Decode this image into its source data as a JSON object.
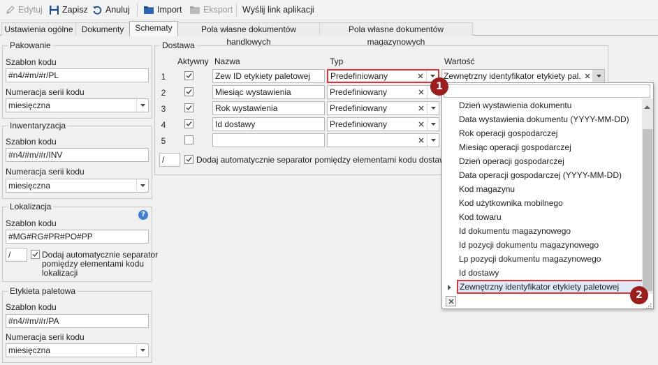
{
  "toolbar": {
    "edit_label": "Edytuj",
    "save_label": "Zapisz",
    "cancel_label": "Anuluj",
    "import_label": "Import",
    "export_label": "Eksport",
    "send_link_label": "Wyślij link aplikacji"
  },
  "tabs": [
    {
      "label": "Ustawienia ogólne",
      "active": false
    },
    {
      "label": "Dokumenty",
      "active": false
    },
    {
      "label": "Schematy",
      "active": true
    },
    {
      "label": "Pola własne dokumentów handlowych",
      "active": false
    },
    {
      "label": "Pola własne dokumentów magazynowych",
      "active": false
    }
  ],
  "left": {
    "pakowanie": {
      "title": "Pakowanie",
      "template_label": "Szablon kodu",
      "template_value": "#n4/#m/#r/PL",
      "numbering_label": "Numeracja serii kodu",
      "numbering_value": "miesięczna"
    },
    "inwentaryzacja": {
      "title": "Inwentaryzacja",
      "template_label": "Szablon kodu",
      "template_value": "#n4/#m/#r/INV",
      "numbering_label": "Numeracja serii kodu",
      "numbering_value": "miesięczna"
    },
    "lokalizacja": {
      "title": "Lokalizacja",
      "template_label": "Szablon kodu",
      "template_value": "#MG#RG#PR#PO#PP",
      "separator_value": "/",
      "auto_separator_label_1": "Dodaj automatycznie separator",
      "auto_separator_label_2": "pomiędzy elementami kodu",
      "auto_separator_label_3": "lokalizacji",
      "auto_separator_checked": true
    },
    "etykieta": {
      "title": "Etykieta paletowa",
      "template_label": "Szablon kodu",
      "template_value": "#n4/#m/#r/PA",
      "numbering_label": "Numeracja serii kodu",
      "numbering_value": "miesięczna"
    }
  },
  "dostawa": {
    "title": "Dostawa",
    "headers": {
      "active": "Aktywny",
      "name": "Nazwa",
      "type": "Typ",
      "value": "Wartość"
    },
    "rows": [
      {
        "num": "1",
        "active": true,
        "name": "Zew ID etykiety paletowej",
        "type": "Predefiniowany",
        "value": "Zewnętrzny identyfikator etykiety pal..."
      },
      {
        "num": "2",
        "active": true,
        "name": "Miesiąc wystawienia",
        "type": "Predefiniowany",
        "value": ""
      },
      {
        "num": "3",
        "active": true,
        "name": "Rok wystawienia",
        "type": "Predefiniowany",
        "value": ""
      },
      {
        "num": "4",
        "active": true,
        "name": "Id dostawy",
        "type": "Predefiniowany",
        "value": ""
      },
      {
        "num": "5",
        "active": false,
        "name": "",
        "type": "",
        "value": ""
      }
    ],
    "separator_value": "/",
    "auto_separator_label": "Dodaj automatycznie separator pomiędzy elementami kodu dostawy",
    "auto_separator_checked": true
  },
  "popup": {
    "items": [
      "Dzień wystawienia dokumentu",
      "Data wystawienia dokumentu (YYYY-MM-DD)",
      "Rok operacji gospodarczej",
      "Miesiąc operacji gospodarczej",
      "Dzień operacji gospodarczej",
      "Data operacji gospodarczej (YYYY-MM-DD)",
      "Kod magazynu",
      "Kod użytkownika mobilnego",
      "Kod towaru",
      "Id dokumentu magazynowego",
      "Id pozycji dokumentu magazynowego",
      "Lp pozycji dokumentu magazynowego",
      "Id dostawy",
      "Zewnętrzny identyfikator etykiety paletowej"
    ],
    "selected_index": 13
  },
  "badges": {
    "first": "1",
    "second": "2"
  },
  "colors": {
    "highlight": "#e03333",
    "badge": "#9c1d1d",
    "selection": "#dfe8f6",
    "scrollbar": "#c2c2c2"
  }
}
